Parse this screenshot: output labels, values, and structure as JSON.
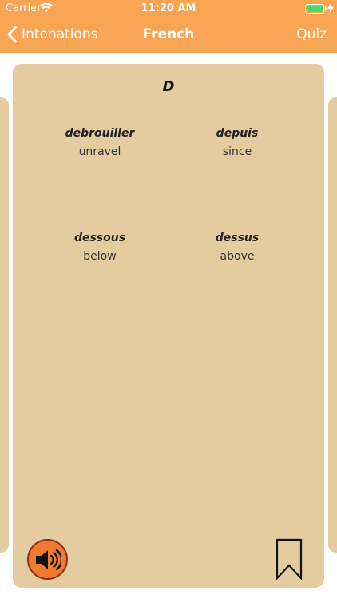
{
  "status_bar": {
    "carrier": "Carrier",
    "time": "11:20 AM",
    "wifi_icon": "wifi-icon",
    "battery_icon": "battery-full-icon",
    "charge_icon": "charging-bolt-icon",
    "battery_color": "#4cd964"
  },
  "nav": {
    "back_label": "Intonations",
    "title": "French",
    "right_label": "Quiz",
    "background_color": "#f7a552",
    "back_icon": "chevron-left-icon"
  },
  "card": {
    "letter": "D",
    "background_color": "#e4cba0",
    "words": [
      {
        "term": "debrouiller",
        "meaning": "unravel"
      },
      {
        "term": "depuis",
        "meaning": "since"
      },
      {
        "term": "dessous",
        "meaning": "below"
      },
      {
        "term": "dessus",
        "meaning": "above"
      }
    ],
    "speaker_icon": "speaker-volume-icon",
    "speaker_color": "#f07a2e",
    "bookmark_icon": "bookmark-icon"
  }
}
